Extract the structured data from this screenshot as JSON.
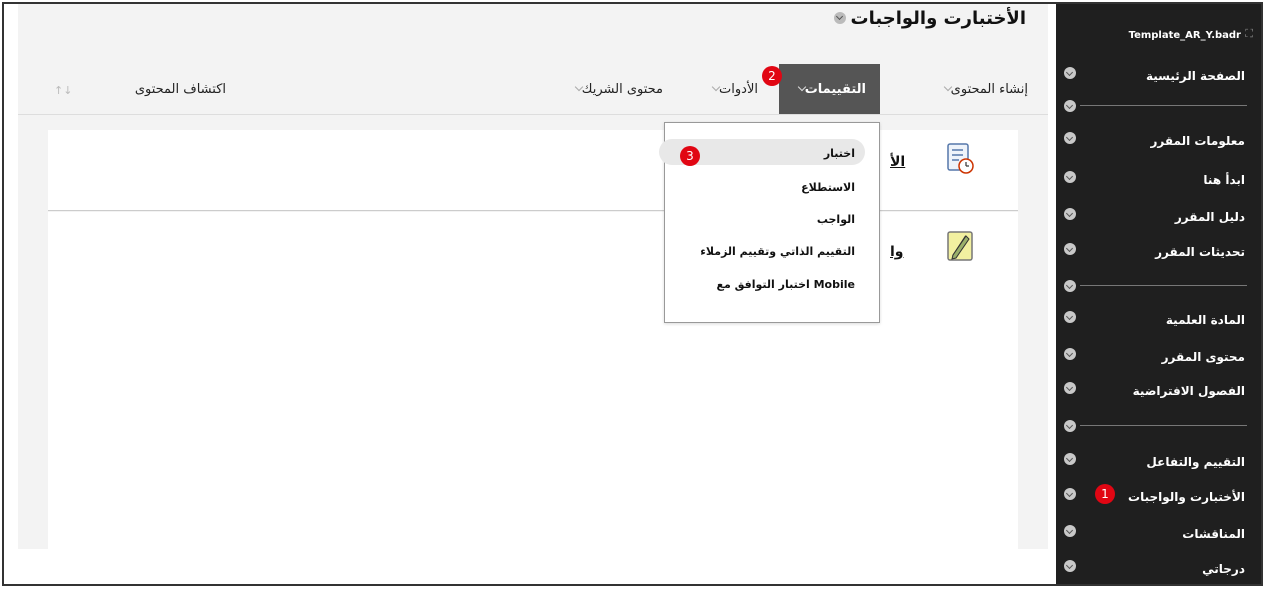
{
  "page": {
    "title": "الأختبارت والواجبات"
  },
  "sidebar": {
    "course_title": "Template_AR_Y.badr",
    "items": [
      {
        "label": "الصفحة الرئيسية"
      },
      {
        "label": "معلومات المقرر"
      },
      {
        "label": "ابدأ هنا"
      },
      {
        "label": "دليل المقرر"
      },
      {
        "label": "تحديثات المقرر"
      },
      {
        "label": "المادة العلمية"
      },
      {
        "label": "محتوى المقرر"
      },
      {
        "label": "الفصول الافتراضية"
      },
      {
        "label": "التقييم والتفاعل"
      },
      {
        "label": "الأختبارت والواجبات"
      },
      {
        "label": "المناقشات"
      },
      {
        "label": "درجاتي"
      }
    ]
  },
  "toolbar": {
    "create_content": "إنشاء المحتوى",
    "assessments": "التقييمات",
    "tools": "الأدوات",
    "partner_content": "محتوى الشريك",
    "discover_content": "اكتشاف المحتوى"
  },
  "content": {
    "row1_title": "الأ",
    "row2_title": "وا"
  },
  "dropdown": {
    "items": [
      {
        "label": "اختبار"
      },
      {
        "label": "الاستطلاع"
      },
      {
        "label": "الواجب"
      },
      {
        "label": "التقييم الذاتي وتقييم الزملاء"
      },
      {
        "label": "اختبار التوافق مع Mobile"
      }
    ]
  },
  "badges": {
    "one": "1",
    "two": "2",
    "three": "3"
  },
  "colors": {
    "sidebar_bg": "#1f1f1f",
    "badge_red": "#e10613",
    "active_tab": "#555555"
  }
}
